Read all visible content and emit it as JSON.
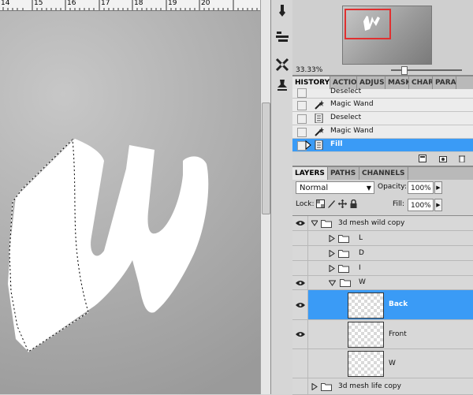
{
  "ruler": {
    "labels": [
      "14",
      "15",
      "16",
      "17",
      "18",
      "19",
      "20"
    ]
  },
  "navigator": {
    "zoom": "33.33%"
  },
  "history": {
    "tabs": [
      "HISTORY",
      "ACTIO",
      "ADJUS",
      "MASK",
      "CHAR",
      "PARA"
    ],
    "items": [
      {
        "label": "Deselect",
        "icon": "document-icon"
      },
      {
        "label": "Magic Wand",
        "icon": "magic-wand-icon"
      },
      {
        "label": "Deselect",
        "icon": "document-icon"
      },
      {
        "label": "Magic Wand",
        "icon": "magic-wand-icon"
      },
      {
        "label": "Fill",
        "icon": "document-icon",
        "selected": true
      }
    ]
  },
  "layers": {
    "tabs": [
      "LAYERS",
      "PATHS",
      "CHANNELS"
    ],
    "blend_mode": "Normal",
    "opacity_label": "Opacity:",
    "opacity_value": "100%",
    "lock_label": "Lock:",
    "fill_label": "Fill:",
    "fill_value": "100%",
    "rows": [
      {
        "name": "3d mesh wild copy",
        "type": "group",
        "expanded": true,
        "visible": true
      },
      {
        "name": "L",
        "type": "group",
        "expanded": false,
        "visible": false
      },
      {
        "name": "D",
        "type": "group",
        "expanded": false,
        "visible": false
      },
      {
        "name": "I",
        "type": "group",
        "expanded": false,
        "visible": false
      },
      {
        "name": "W",
        "type": "group",
        "expanded": true,
        "visible": true
      },
      {
        "name": "Back",
        "type": "layer",
        "visible": true,
        "selected": true
      },
      {
        "name": "Front",
        "type": "layer",
        "visible": true
      },
      {
        "name": "W",
        "type": "layer",
        "visible": false
      },
      {
        "name": "3d mesh life copy",
        "type": "group",
        "expanded": false,
        "visible": false
      }
    ]
  },
  "colors": {
    "selection": "#3a9bf6",
    "nav_view_box": "#e03030"
  }
}
